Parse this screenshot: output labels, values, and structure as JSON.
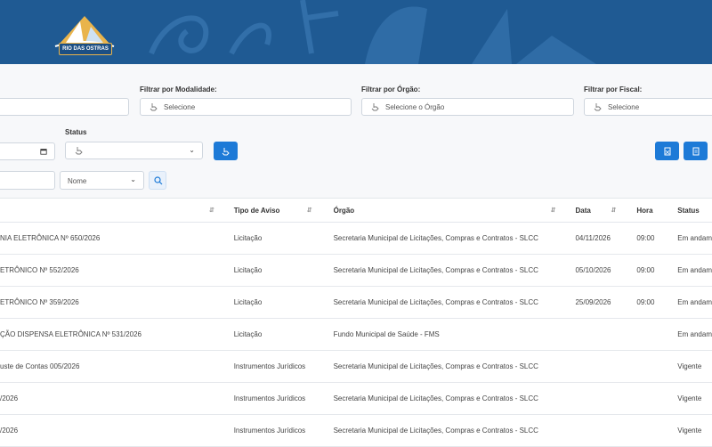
{
  "header": {
    "logo_text": "RIO DAS OSTRAS"
  },
  "filters": {
    "modalidade_label": "Filtrar por Modalidade:",
    "modalidade_placeholder": "Selecione",
    "orgao_label": "Filtrar por Órgão:",
    "orgao_placeholder": "Selecione o Órgão",
    "fiscal_label": "Filtrar por Fiscal:",
    "fiscal_placeholder": "Selecione",
    "status_label": "Status",
    "search_field_value": "Nome"
  },
  "table": {
    "columns": [
      "Tipo de Aviso",
      "Órgão",
      "Data",
      "Hora",
      "Status"
    ],
    "rows": [
      {
        "title": "NIA ELETRÔNICA Nº 650/2026",
        "tipo": "Licitação",
        "orgao": "Secretaria Municipal de Licitações, Compras e Contratos - SLCC",
        "data": "04/11/2026",
        "hora": "09:00",
        "status": "Em andam"
      },
      {
        "title": "ETRÔNICO Nº 552/2026",
        "tipo": "Licitação",
        "orgao": "Secretaria Municipal de Licitações, Compras e Contratos - SLCC",
        "data": "05/10/2026",
        "hora": "09:00",
        "status": "Em andam"
      },
      {
        "title": "ETRÔNICO Nº 359/2026",
        "tipo": "Licitação",
        "orgao": "Secretaria Municipal de Licitações, Compras e Contratos - SLCC",
        "data": "25/09/2026",
        "hora": "09:00",
        "status": "Em andam"
      },
      {
        "title": "ÇÃO DISPENSA ELETRÔNICA Nº 531/2026",
        "tipo": "Licitação",
        "orgao": "Fundo Municipal de Saúde - FMS",
        "data": "",
        "hora": "",
        "status": "Em andam"
      },
      {
        "title": "uste de Contas 005/2026",
        "tipo": "Instrumentos Jurídicos",
        "orgao": "Secretaria Municipal de Licitações, Compras e Contratos - SLCC",
        "data": "",
        "hora": "",
        "status": "Vigente"
      },
      {
        "title": "/2026",
        "tipo": "Instrumentos Jurídicos",
        "orgao": "Secretaria Municipal de Licitações, Compras e Contratos - SLCC",
        "data": "",
        "hora": "",
        "status": "Vigente"
      },
      {
        "title": "/2026",
        "tipo": "Instrumentos Jurídicos",
        "orgao": "Secretaria Municipal de Licitações, Compras e Contratos - SLCC",
        "data": "",
        "hora": "",
        "status": "Vigente"
      }
    ]
  },
  "icons": {
    "select": "hand-pointer-icon",
    "calendar": "calendar-icon",
    "search": "search-icon",
    "export_xls": "spreadsheet-icon",
    "export_pdf": "pdf-icon"
  },
  "colors": {
    "header": "#1f5a93",
    "primary_button": "#1d7ad7"
  }
}
